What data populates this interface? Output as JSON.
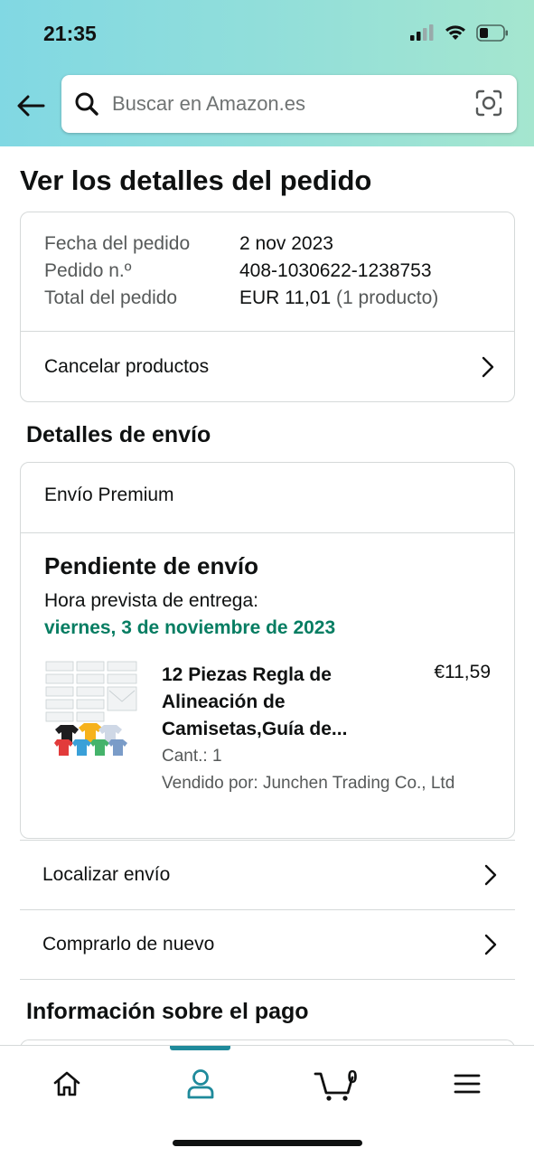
{
  "status_bar": {
    "time": "21:35"
  },
  "search": {
    "placeholder": "Buscar en Amazon.es"
  },
  "page": {
    "title": "Ver los detalles del pedido"
  },
  "order": {
    "date_label": "Fecha del pedido",
    "date_value": "2 nov 2023",
    "number_label": "Pedido n.º",
    "number_value": "408-1030622-1238753",
    "total_label": "Total del pedido",
    "total_value": "EUR 11,01",
    "total_items": "(1 producto)",
    "cancel_label": "Cancelar productos"
  },
  "shipping": {
    "section_title": "Detalles de envío",
    "method": "Envío Premium",
    "status": "Pendiente de envío",
    "eta_label": "Hora prevista de entrega:",
    "eta_date": "viernes, 3 de noviembre de 2023",
    "product": {
      "title": "12 Piezas Regla de Alineación de Camisetas,Guía de...",
      "price": "€11,59",
      "qty": "Cant.: 1",
      "seller": "Vendido por: Junchen Trading Co., Ltd"
    }
  },
  "actions": {
    "track": "Localizar envío",
    "buy_again": "Comprarlo de nuevo"
  },
  "payment": {
    "section_title": "Información sobre el pago"
  },
  "tabbar": {
    "active_tab": "account",
    "cart_count": "0",
    "accent_color": "#1f8a9b"
  },
  "colors": {
    "header_gradient_start": "#81d8e3",
    "header_gradient_end": "#a5e6cf",
    "eta_green": "#067d62"
  }
}
